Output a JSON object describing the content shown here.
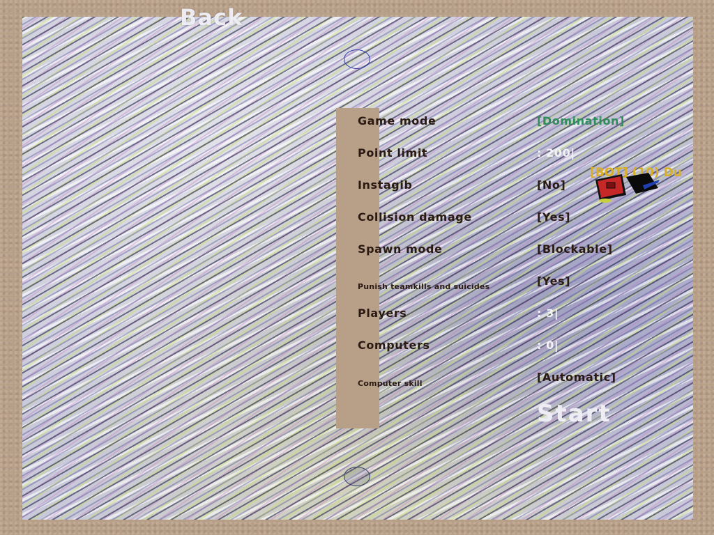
{
  "header": {
    "back_label": "Back"
  },
  "options": [
    {
      "label": "Game mode",
      "value": "[Domination]"
    },
    {
      "label": "Point limit",
      "value": ": 200|"
    },
    {
      "label": "Instagib",
      "value": "[No]"
    },
    {
      "label": "Collision damage",
      "value": "[Yes]"
    },
    {
      "label": "Spawn mode",
      "value": "[Blockable]"
    },
    {
      "label": "Punish teamkills and suicides",
      "value": "[Yes]"
    },
    {
      "label": "Players",
      "value": ": 3|"
    },
    {
      "label": "Computers",
      "value": ": 0|"
    },
    {
      "label": "Computer skill",
      "value": "[Automatic]"
    }
  ],
  "start_label": "Start",
  "bot": {
    "label": "[BOT] (10) Du"
  },
  "colors": {
    "label_text": "#2a1a12",
    "value_accent": "#2f8f5a",
    "value_light": "#f2f2f6",
    "bot_label": "#d8b022",
    "border": "#b89f88"
  },
  "icons": {
    "scroll_up": "circle-outline-icon",
    "scroll_down": "circle-outline-icon",
    "ship": "bot-ship-icon"
  }
}
